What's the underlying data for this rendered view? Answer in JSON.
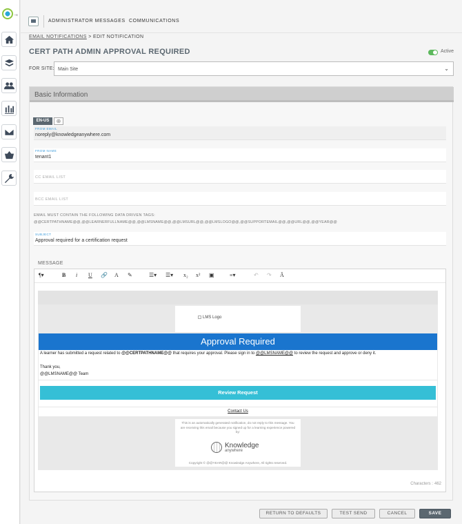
{
  "topbar": {
    "tabs": [
      "ADMINISTRATOR MESSAGES",
      "COMMUNICATIONS"
    ]
  },
  "breadcrumb": {
    "parent": "EMAIL NOTIFICATIONS",
    "separator": ">",
    "current": "EDIT NOTIFICATION"
  },
  "page": {
    "title": "CERT PATH ADMIN APPROVAL REQUIRED",
    "status_label": "Active",
    "for_site_label": "FOR SITE:",
    "site_value": "Main Site"
  },
  "panel": {
    "title": "Basic Information",
    "language_tab": "EN-US",
    "add_language": "⊕"
  },
  "fields": {
    "from_email": {
      "label": "FROM EMAIL",
      "value": "noreply@knowledgeanywhere.com"
    },
    "from_name": {
      "label": "FROM NAME",
      "value": "tenant1"
    },
    "cc": {
      "placeholder": "CC EMAIL LIST"
    },
    "bcc": {
      "placeholder": "BCC EMAIL LIST"
    },
    "subject": {
      "label": "SUBJECT",
      "value": "Approval required for a certification request"
    }
  },
  "tags": {
    "label": "EMAIL MUST CONTAIN THE FOLLOWING DATA DRIVEN TAGS:",
    "value": "@@CERTPATHNAME@@,@@LEARNERFULLNAME@@,@@LMSNAME@@,@@LMSURL@@,@@LMSLOGO@@,@@SUPPORTEMAIL@@,@@URL@@,@@YEAR@@"
  },
  "editor": {
    "label": "MESSAGE",
    "toolbar": {
      "paragraph": "¶",
      "bold": "B",
      "italic": "i",
      "underline": "U",
      "link": "🔗",
      "font_color": "A",
      "highlight": "✎",
      "ordered_list": "☰",
      "unordered_list": "☰",
      "subscript": "x₂",
      "superscript": "x²",
      "image": "▣",
      "align": "≡",
      "undo": "↶",
      "redo": "↷",
      "clear_format": "Ā"
    },
    "email": {
      "logo_alt": "LMS Logo",
      "banner": "Approval Required",
      "line1_a": "A learner has submitted a request related to ",
      "line1_b": "@@CERTPATHNAME@@",
      "line1_c": " that requires your approval. Please sign in to ",
      "line1_d": "@@LMSNAME@@",
      "line1_e": " to review the request and approve or deny it.",
      "thanks": "Thank you,",
      "signature": "@@LMSNAME@@ Team",
      "review_button": "Review Request",
      "contact": "Contact Us",
      "footnote": "This is an automatically generated notification, do not reply to this message. You are receiving this email because you signed up for a learning experience powered by:",
      "brand_line1": "Knowledge",
      "brand_line2": "anywhere",
      "copyright": "Copyright © @@YEAR@@ Knowledge Anywhere, All rights reserved."
    },
    "char_label": "Characters :",
    "char_count": "462"
  },
  "actions": {
    "reset": "RETURN TO DEFAULTS",
    "test": "TEST SEND",
    "cancel": "CANCEL",
    "save": "SAVE"
  },
  "colors": {
    "banner": "#1a75ce",
    "review_button": "#35bfd6",
    "active_toggle": "#5cb85c",
    "primary": "#5b6770"
  }
}
